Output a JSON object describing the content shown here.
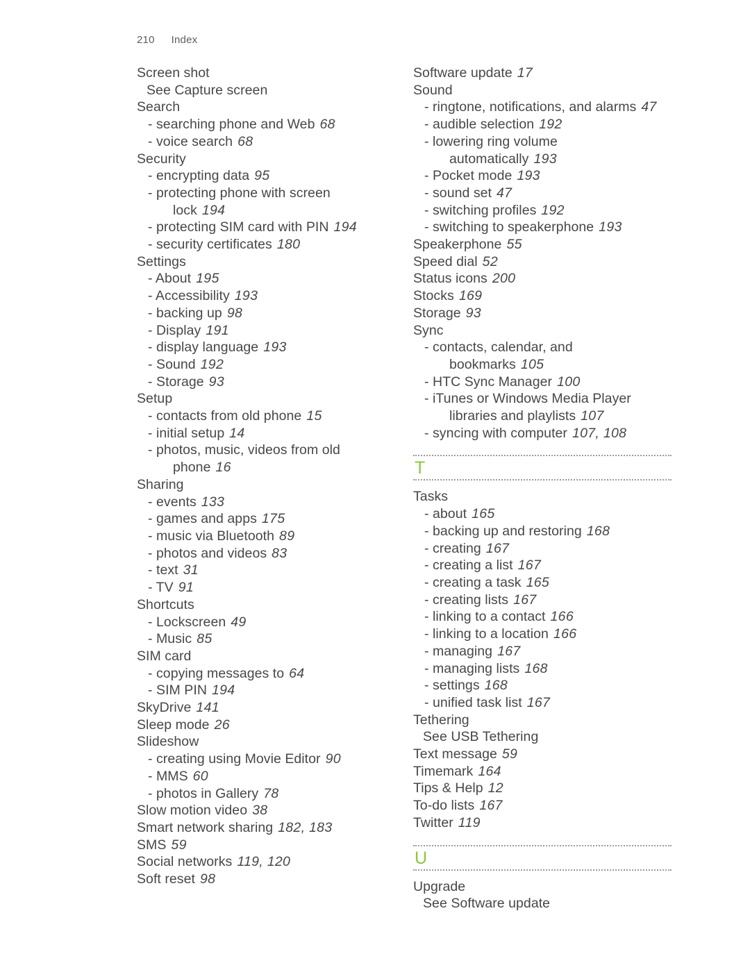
{
  "page": {
    "folio": "210",
    "running_head": "Index",
    "accent_color": "#8dc63f",
    "text_color": "#474747",
    "rule_color": "#9a9a9a"
  },
  "columns": [
    {
      "name": "left-column",
      "blocks": [
        {
          "type": "entry",
          "level": 1,
          "text": "Screen shot",
          "page": ""
        },
        {
          "type": "entry",
          "level": "see",
          "text": "See Capture screen",
          "page": ""
        },
        {
          "type": "entry",
          "level": 1,
          "text": "Search",
          "page": ""
        },
        {
          "type": "entry",
          "level": 2,
          "text": "- searching phone and Web",
          "page": "68"
        },
        {
          "type": "entry",
          "level": 2,
          "text": "- voice search",
          "page": "68"
        },
        {
          "type": "entry",
          "level": 1,
          "text": "Security",
          "page": ""
        },
        {
          "type": "entry",
          "level": 2,
          "text": "- encrypting data",
          "page": "95"
        },
        {
          "type": "entry",
          "level": 2,
          "text": "- protecting phone with screen",
          "page": ""
        },
        {
          "type": "entry",
          "level": "cont",
          "text": "lock",
          "page": "194"
        },
        {
          "type": "entry",
          "level": 2,
          "text": "- protecting SIM card with PIN",
          "page": "194"
        },
        {
          "type": "entry",
          "level": 2,
          "text": "- security certificates",
          "page": "180"
        },
        {
          "type": "entry",
          "level": 1,
          "text": "Settings",
          "page": ""
        },
        {
          "type": "entry",
          "level": 2,
          "text": "- About",
          "page": "195"
        },
        {
          "type": "entry",
          "level": 2,
          "text": "- Accessibility",
          "page": "193"
        },
        {
          "type": "entry",
          "level": 2,
          "text": "- backing up",
          "page": "98"
        },
        {
          "type": "entry",
          "level": 2,
          "text": "- Display",
          "page": "191"
        },
        {
          "type": "entry",
          "level": 2,
          "text": "- display language",
          "page": "193"
        },
        {
          "type": "entry",
          "level": 2,
          "text": "- Sound",
          "page": "192"
        },
        {
          "type": "entry",
          "level": 2,
          "text": "- Storage",
          "page": "93"
        },
        {
          "type": "entry",
          "level": 1,
          "text": "Setup",
          "page": ""
        },
        {
          "type": "entry",
          "level": 2,
          "text": "- contacts from old phone",
          "page": "15"
        },
        {
          "type": "entry",
          "level": 2,
          "text": "- initial setup",
          "page": "14"
        },
        {
          "type": "entry",
          "level": 2,
          "text": "- photos, music, videos from old",
          "page": ""
        },
        {
          "type": "entry",
          "level": "cont",
          "text": "phone",
          "page": "16"
        },
        {
          "type": "entry",
          "level": 1,
          "text": "Sharing",
          "page": ""
        },
        {
          "type": "entry",
          "level": 2,
          "text": "- events",
          "page": "133"
        },
        {
          "type": "entry",
          "level": 2,
          "text": "- games and apps",
          "page": "175"
        },
        {
          "type": "entry",
          "level": 2,
          "text": "- music via Bluetooth",
          "page": "89"
        },
        {
          "type": "entry",
          "level": 2,
          "text": "- photos and videos",
          "page": "83"
        },
        {
          "type": "entry",
          "level": 2,
          "text": "- text",
          "page": "31"
        },
        {
          "type": "entry",
          "level": 2,
          "text": "- TV",
          "page": "91"
        },
        {
          "type": "entry",
          "level": 1,
          "text": "Shortcuts",
          "page": ""
        },
        {
          "type": "entry",
          "level": 2,
          "text": "- Lockscreen",
          "page": "49"
        },
        {
          "type": "entry",
          "level": 2,
          "text": "- Music",
          "page": "85"
        },
        {
          "type": "entry",
          "level": 1,
          "text": "SIM card",
          "page": ""
        },
        {
          "type": "entry",
          "level": 2,
          "text": "- copying messages to",
          "page": "64"
        },
        {
          "type": "entry",
          "level": 2,
          "text": "- SIM PIN",
          "page": "194"
        },
        {
          "type": "entry",
          "level": 1,
          "text": "SkyDrive",
          "page": "141"
        },
        {
          "type": "entry",
          "level": 1,
          "text": "Sleep mode",
          "page": "26"
        },
        {
          "type": "entry",
          "level": 1,
          "text": "Slideshow",
          "page": ""
        },
        {
          "type": "entry",
          "level": 2,
          "text": "- creating using Movie Editor",
          "page": "90"
        },
        {
          "type": "entry",
          "level": 2,
          "text": "- MMS",
          "page": "60"
        },
        {
          "type": "entry",
          "level": 2,
          "text": "- photos in Gallery",
          "page": "78"
        },
        {
          "type": "entry",
          "level": 1,
          "text": "Slow motion video",
          "page": "38"
        },
        {
          "type": "entry",
          "level": 1,
          "text": "Smart network sharing",
          "page": "182, 183"
        },
        {
          "type": "entry",
          "level": 1,
          "text": "SMS",
          "page": "59"
        },
        {
          "type": "entry",
          "level": 1,
          "text": "Social networks",
          "page": "119, 120"
        },
        {
          "type": "entry",
          "level": 1,
          "text": "Soft reset",
          "page": "98"
        }
      ]
    },
    {
      "name": "right-column",
      "blocks": [
        {
          "type": "entry",
          "level": 1,
          "text": "Software update",
          "page": "17"
        },
        {
          "type": "entry",
          "level": 1,
          "text": "Sound",
          "page": ""
        },
        {
          "type": "entry",
          "level": 2,
          "text": "- ringtone, notifications, and alarms",
          "page": "47"
        },
        {
          "type": "entry",
          "level": 2,
          "text": "- audible selection",
          "page": "192"
        },
        {
          "type": "entry",
          "level": 2,
          "text": "- lowering ring volume",
          "page": ""
        },
        {
          "type": "entry",
          "level": "cont",
          "text": "automatically",
          "page": "193"
        },
        {
          "type": "entry",
          "level": 2,
          "text": "- Pocket mode",
          "page": "193"
        },
        {
          "type": "entry",
          "level": 2,
          "text": "- sound set",
          "page": "47"
        },
        {
          "type": "entry",
          "level": 2,
          "text": "- switching profiles",
          "page": "192"
        },
        {
          "type": "entry",
          "level": 2,
          "text": "- switching to speakerphone",
          "page": "193"
        },
        {
          "type": "entry",
          "level": 1,
          "text": "Speakerphone",
          "page": "55"
        },
        {
          "type": "entry",
          "level": 1,
          "text": "Speed dial",
          "page": "52"
        },
        {
          "type": "entry",
          "level": 1,
          "text": "Status icons",
          "page": "200"
        },
        {
          "type": "entry",
          "level": 1,
          "text": "Stocks",
          "page": "169"
        },
        {
          "type": "entry",
          "level": 1,
          "text": "Storage",
          "page": "93"
        },
        {
          "type": "entry",
          "level": 1,
          "text": "Sync",
          "page": ""
        },
        {
          "type": "entry",
          "level": 2,
          "text": "- contacts, calendar, and",
          "page": ""
        },
        {
          "type": "entry",
          "level": "cont",
          "text": "bookmarks",
          "page": "105"
        },
        {
          "type": "entry",
          "level": 2,
          "text": "- HTC Sync Manager",
          "page": "100"
        },
        {
          "type": "entry",
          "level": 2,
          "text": "- iTunes or Windows Media Player",
          "page": ""
        },
        {
          "type": "entry",
          "level": "cont",
          "text": "libraries and playlists",
          "page": "107"
        },
        {
          "type": "entry",
          "level": 2,
          "text": "- syncing with computer",
          "page": "107, 108"
        },
        {
          "type": "letter",
          "letter": "T"
        },
        {
          "type": "entry",
          "level": 1,
          "text": "Tasks",
          "page": ""
        },
        {
          "type": "entry",
          "level": 2,
          "text": "- about",
          "page": "165"
        },
        {
          "type": "entry",
          "level": 2,
          "text": "- backing up and restoring",
          "page": "168"
        },
        {
          "type": "entry",
          "level": 2,
          "text": "- creating",
          "page": "167"
        },
        {
          "type": "entry",
          "level": 2,
          "text": "- creating a list",
          "page": "167"
        },
        {
          "type": "entry",
          "level": 2,
          "text": "- creating a task",
          "page": "165"
        },
        {
          "type": "entry",
          "level": 2,
          "text": "- creating lists",
          "page": "167"
        },
        {
          "type": "entry",
          "level": 2,
          "text": "- linking to a contact",
          "page": "166"
        },
        {
          "type": "entry",
          "level": 2,
          "text": "- linking to a location",
          "page": "166"
        },
        {
          "type": "entry",
          "level": 2,
          "text": "- managing",
          "page": "167"
        },
        {
          "type": "entry",
          "level": 2,
          "text": "- managing lists",
          "page": "168"
        },
        {
          "type": "entry",
          "level": 2,
          "text": "- settings",
          "page": "168"
        },
        {
          "type": "entry",
          "level": 2,
          "text": "- unified task list",
          "page": "167"
        },
        {
          "type": "entry",
          "level": 1,
          "text": "Tethering",
          "page": ""
        },
        {
          "type": "entry",
          "level": "see",
          "text": "See USB Tethering",
          "page": ""
        },
        {
          "type": "entry",
          "level": 1,
          "text": "Text message",
          "page": "59"
        },
        {
          "type": "entry",
          "level": 1,
          "text": "Timemark",
          "page": "164"
        },
        {
          "type": "entry",
          "level": 1,
          "text": "Tips & Help",
          "page": "12"
        },
        {
          "type": "entry",
          "level": 1,
          "text": "To-do lists",
          "page": "167"
        },
        {
          "type": "entry",
          "level": 1,
          "text": "Twitter",
          "page": "119"
        },
        {
          "type": "letter",
          "letter": "U"
        },
        {
          "type": "entry",
          "level": 1,
          "text": "Upgrade",
          "page": ""
        },
        {
          "type": "entry",
          "level": "see",
          "text": "See Software update",
          "page": ""
        }
      ]
    }
  ]
}
